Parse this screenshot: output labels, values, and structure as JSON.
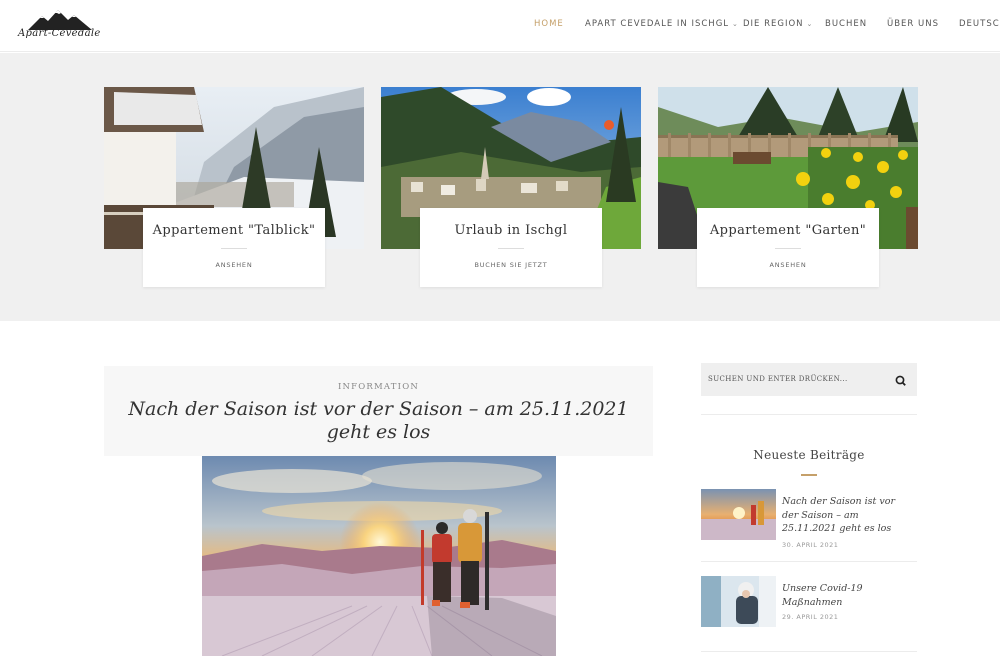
{
  "header": {
    "logo_text": "Apart-Cevedale",
    "nav": [
      {
        "label": "HOME",
        "active": true,
        "dropdown": false
      },
      {
        "label": "APART CEVEDALE IN ISCHGL",
        "active": false,
        "dropdown": true
      },
      {
        "label": "DIE REGION",
        "active": false,
        "dropdown": true
      },
      {
        "label": "BUCHEN",
        "active": false,
        "dropdown": false
      },
      {
        "label": "ÜBER UNS",
        "active": false,
        "dropdown": false
      },
      {
        "label": "DEUTSCH",
        "active": false,
        "dropdown": false
      }
    ]
  },
  "featured": [
    {
      "title": "Appartement \"Talblick\"",
      "link": "ANSEHEN"
    },
    {
      "title": "Urlaub in Ischgl",
      "link": "BUCHEN SIE JETZT"
    },
    {
      "title": "Appartement \"Garten\"",
      "link": "ANSEHEN"
    }
  ],
  "post": {
    "category": "INFORMATION",
    "title": "Nach der Saison ist vor der Saison – am 25.11.2021 geht es los"
  },
  "sidebar": {
    "search_placeholder": "SUCHEN UND ENTER DRÜCKEN...",
    "recent_title": "Neueste Beiträge",
    "recent": [
      {
        "title": "Nach der Saison ist vor der Saison – am 25.11.2021 geht es los",
        "date": "30. APRIL 2021"
      },
      {
        "title": "Unsere Covid-19 Maßnahmen",
        "date": "29. APRIL 2021"
      }
    ]
  },
  "colors": {
    "accent": "#c5a06a",
    "band": "#f0f0f0",
    "post_head": "#f7f7f7"
  }
}
